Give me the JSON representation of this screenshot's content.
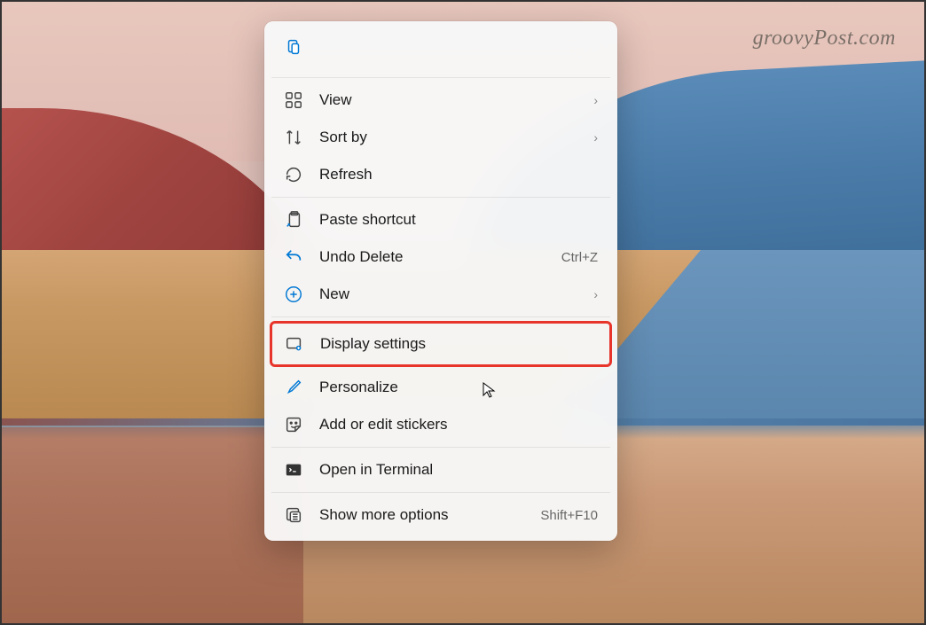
{
  "watermark": "groovyPost.com",
  "menu": {
    "items": {
      "view": {
        "label": "View",
        "has_submenu": true
      },
      "sort_by": {
        "label": "Sort by",
        "has_submenu": true
      },
      "refresh": {
        "label": "Refresh"
      },
      "paste_shortcut": {
        "label": "Paste shortcut"
      },
      "undo_delete": {
        "label": "Undo Delete",
        "shortcut": "Ctrl+Z"
      },
      "new": {
        "label": "New",
        "has_submenu": true
      },
      "display_settings": {
        "label": "Display settings",
        "highlighted": true
      },
      "personalize": {
        "label": "Personalize"
      },
      "add_stickers": {
        "label": "Add or edit stickers"
      },
      "open_terminal": {
        "label": "Open in Terminal"
      },
      "show_more": {
        "label": "Show more options",
        "shortcut": "Shift+F10"
      }
    }
  }
}
